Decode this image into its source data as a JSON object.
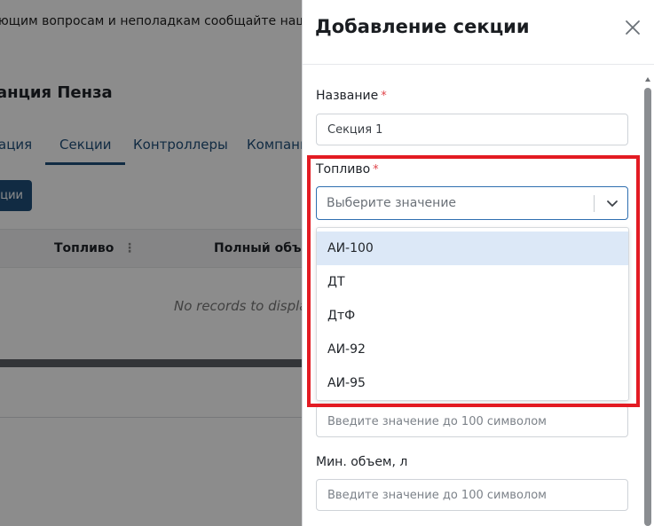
{
  "background": {
    "notice_text": "ющим вопросам и неполадкам сообщайте нашей т",
    "page_title": "анция Пенза",
    "tabs": [
      {
        "label": "ация"
      },
      {
        "label": "Секции",
        "active": true
      },
      {
        "label": "Контроллеры"
      },
      {
        "label": "Компани"
      }
    ],
    "add_button_label": "ции",
    "table_headers": [
      "Топливо",
      "Полный объем"
    ],
    "empty_text": "No records to displa"
  },
  "drawer": {
    "title": "Добавление секции",
    "close_icon": "close-icon",
    "name_field": {
      "label": "Название",
      "required_mark": "*",
      "value": "Секция 1"
    },
    "fuel_field": {
      "label": "Топливо",
      "required_mark": "*",
      "placeholder": "Выберите значение",
      "options": [
        "АИ-100",
        "ДТ",
        "ДтФ",
        "АИ-92",
        "АИ-95"
      ],
      "highlighted_option": "АИ-100"
    },
    "full_volume_field": {
      "placeholder": "Введите значение до 100 символом"
    },
    "min_volume_field": {
      "label": "Мин. объем, л",
      "placeholder": "Введите значение до 100 символом"
    }
  },
  "colors": {
    "accent": "#1f4f7a",
    "focus_border": "#2f6fb0",
    "highlight_box": "#e31b23",
    "option_hover": "#dce8f7"
  }
}
